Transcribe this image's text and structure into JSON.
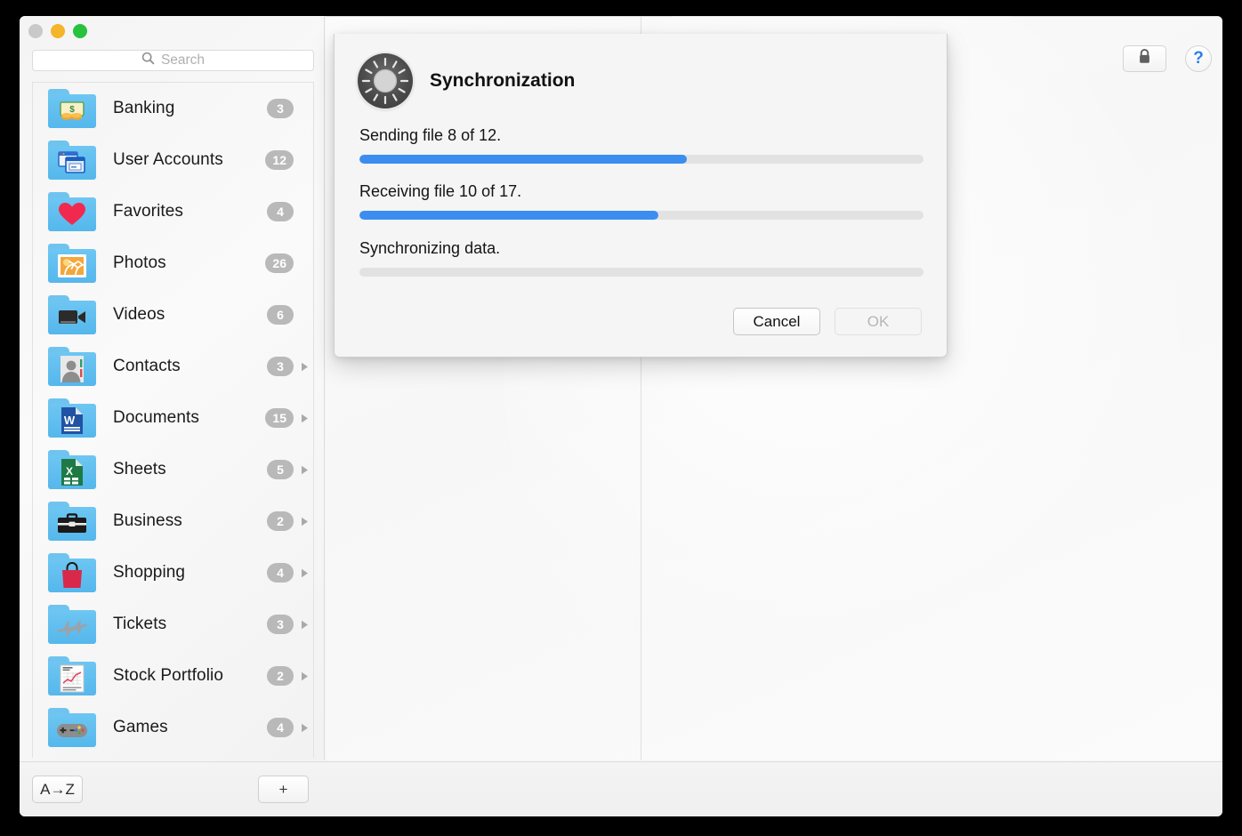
{
  "window": {
    "traffic_lights": [
      {
        "name": "close",
        "color": "#c9c9c9"
      },
      {
        "name": "minimize",
        "color": "#f5b429"
      },
      {
        "name": "zoom",
        "color": "#27c23e"
      }
    ]
  },
  "toolbar": {
    "search": {
      "placeholder": "Search",
      "value": "",
      "icon": "search-icon"
    },
    "lock_button": {
      "icon": "lock-icon",
      "label": ""
    },
    "help_button": {
      "icon": "help-icon",
      "label": "?"
    }
  },
  "sidebar": {
    "items": [
      {
        "label": "Banking",
        "badge": "3",
        "icon": "folder-banking-icon",
        "has_disclosure": false
      },
      {
        "label": "User Accounts",
        "badge": "12",
        "icon": "folder-user-accounts-icon",
        "has_disclosure": false
      },
      {
        "label": "Favorites",
        "badge": "4",
        "icon": "folder-favorites-icon",
        "has_disclosure": false
      },
      {
        "label": "Photos",
        "badge": "26",
        "icon": "folder-photos-icon",
        "has_disclosure": false
      },
      {
        "label": "Videos",
        "badge": "6",
        "icon": "folder-videos-icon",
        "has_disclosure": false
      },
      {
        "label": "Contacts",
        "badge": "3",
        "icon": "folder-contacts-icon",
        "has_disclosure": true
      },
      {
        "label": "Documents",
        "badge": "15",
        "icon": "folder-documents-icon",
        "has_disclosure": true
      },
      {
        "label": "Sheets",
        "badge": "5",
        "icon": "folder-sheets-icon",
        "has_disclosure": true
      },
      {
        "label": "Business",
        "badge": "2",
        "icon": "folder-business-icon",
        "has_disclosure": true
      },
      {
        "label": "Shopping",
        "badge": "4",
        "icon": "folder-shopping-icon",
        "has_disclosure": true
      },
      {
        "label": "Tickets",
        "badge": "3",
        "icon": "folder-tickets-icon",
        "has_disclosure": true
      },
      {
        "label": "Stock Portfolio",
        "badge": "2",
        "icon": "folder-stock-icon",
        "has_disclosure": true
      },
      {
        "label": "Games",
        "badge": "4",
        "icon": "folder-games-icon",
        "has_disclosure": true
      }
    ]
  },
  "bottom_bar": {
    "sort_button": {
      "label": "A→Z",
      "icon": "sort-az-icon"
    },
    "add_button": {
      "label": "+",
      "icon": "plus-icon"
    }
  },
  "dialog": {
    "title": "Synchronization",
    "icon": "vault-dial-icon",
    "progress": [
      {
        "label": "Sending file 8 of 12.",
        "percent": 58,
        "indeterminate": false
      },
      {
        "label": "Receiving file 10 of 17.",
        "percent": 53,
        "indeterminate": false
      },
      {
        "label": "Synchronizing data.",
        "percent": 0,
        "indeterminate": true
      }
    ],
    "buttons": {
      "cancel": {
        "label": "Cancel",
        "enabled": true
      },
      "ok": {
        "label": "OK",
        "enabled": false
      }
    }
  },
  "colors": {
    "accent_blue": "#3b8ef0",
    "badge_gray": "#b9b9b9",
    "folder_blue": "#55b7ec",
    "help_blue": "#2d7fe8"
  }
}
